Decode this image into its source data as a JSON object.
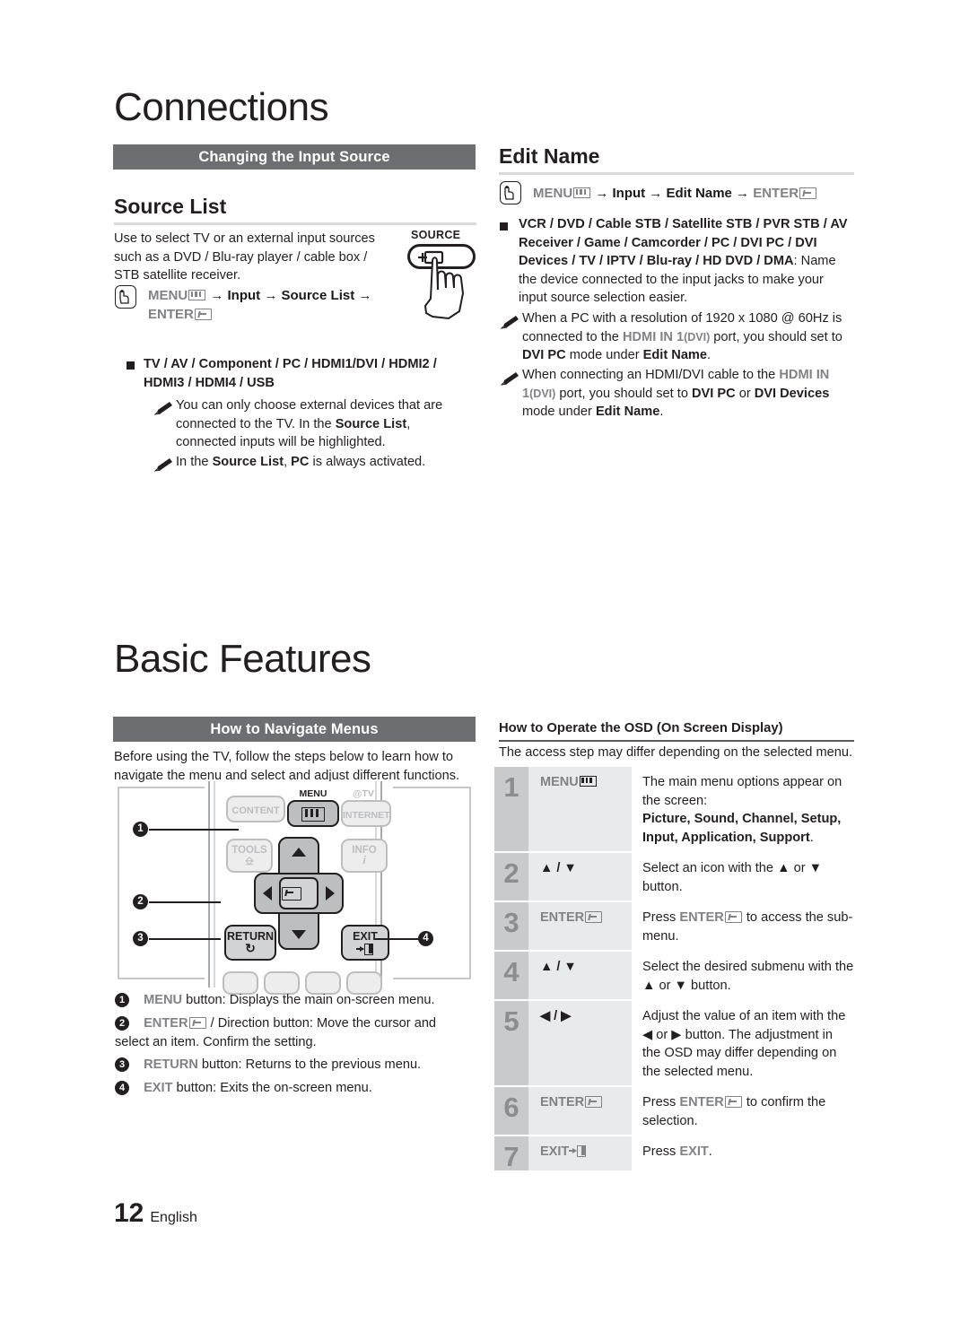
{
  "document": {
    "chapters": [
      {
        "id": "connections",
        "title": "Connections"
      },
      {
        "id": "basic",
        "title": "Basic Features"
      }
    ],
    "footer": {
      "page_number": "12",
      "language": "English"
    }
  },
  "connections": {
    "section_bar": "Changing the Input Source",
    "source_list": {
      "heading": "Source List",
      "description": "Use to select TV or an external input sources such as a DVD / Blu-ray player / cable box / STB satellite receiver.",
      "path": {
        "menu": "MENU",
        "sep1": "→",
        "item1": "Input",
        "sep2": "→",
        "item2": "Source List",
        "sep3": "→",
        "enter": "ENTER"
      },
      "bullet": "TV / AV / Component / PC / HDMI1/DVI / HDMI2 / HDMI3 / HDMI4 / USB",
      "notes": [
        {
          "p1": "You can only choose external devices that are connected to the TV. In the ",
          "b1": "Source List",
          "p2": ", connected inputs will be highlighted."
        },
        {
          "p1": "In the ",
          "b1": "Source List",
          "p2": ", ",
          "b2": "PC",
          "p3": " is always activated."
        }
      ],
      "illustration": {
        "button_label": "SOURCE"
      }
    },
    "edit_name": {
      "heading": "Edit Name",
      "path": {
        "menu": "MENU",
        "sep1": "→",
        "item1": "Input",
        "sep2": "→",
        "item2": "Edit Name",
        "sep3": "→",
        "enter": "ENTER"
      },
      "bullet_bold": "VCR / DVD / Cable STB / Satellite STB / PVR STB / AV Receiver / Game / Camcorder / PC / DVI PC / DVI Devices / TV / IPTV / Blu-ray / HD DVD / DMA",
      "bullet_rest": ": Name the device connected to the input jacks to make your input source selection easier.",
      "notes": [
        {
          "p1": "When a PC with a resolution of 1920 x 1080 @ 60Hz is connected to the ",
          "g1": "HDMI IN 1",
          "g2": "(DVI)",
          "p2": " port, you should set to ",
          "b1": "DVI PC",
          "p3": " mode under ",
          "b2": "Edit Name",
          "p4": "."
        },
        {
          "p1": "When connecting an HDMI/DVI cable to the ",
          "g1": "HDMI IN 1",
          "g2": "(DVI)",
          "p2": " port, you should set to ",
          "b1": "DVI PC",
          "p3": " or ",
          "b2": "DVI Devices",
          "p4": " mode under ",
          "b3": "Edit Name",
          "p5": "."
        }
      ]
    }
  },
  "basic_features": {
    "section_bar": "How to Navigate Menus",
    "intro": "Before using the TV, follow the steps below to learn how to navigate the menu and select and adjust different functions.",
    "remote": {
      "buttons": {
        "content": "CONTENT",
        "menu_label": "MENU",
        "attv_label": "@TV",
        "internet": "INTERNET",
        "tools": "TOOLS",
        "info": "INFO",
        "return": "RETURN",
        "exit": "EXIT"
      },
      "callouts": [
        "1",
        "2",
        "3",
        "4"
      ]
    },
    "legend": [
      {
        "num": "1",
        "key": "MENU",
        "text": " button: Displays the main on-screen menu."
      },
      {
        "num": "2",
        "key": "ENTER",
        "text": " / Direction button: Move the cursor and select an item. Confirm the setting."
      },
      {
        "num": "3",
        "key": "RETURN",
        "text": " button: Returns to the previous menu."
      },
      {
        "num": "4",
        "key": "EXIT",
        "text": " button: Exits the on-screen menu."
      }
    ],
    "osd": {
      "heading": "How to Operate the OSD (On Screen Display)",
      "intro": "The access step may differ depending on the selected menu.",
      "rows": [
        {
          "num": "1",
          "key": "MENU",
          "key_glyph": "menu",
          "desc_pre": "The main menu options appear on the screen:",
          "desc_bold": "Picture, Sound, Channel, Setup, Input, Application, Support",
          "desc_post": "."
        },
        {
          "num": "2",
          "key": "▲ / ▼",
          "key_glyph": "none",
          "desc_pre": "Select an icon with the ▲ or ▼ button.",
          "desc_bold": "",
          "desc_post": ""
        },
        {
          "num": "3",
          "key": "ENTER",
          "key_glyph": "enter",
          "desc_pre": "Press ",
          "desc_mid_key": "ENTER",
          "desc_mid_glyph": "enter",
          "desc_post": " to access the sub-menu.",
          "desc_bold": ""
        },
        {
          "num": "4",
          "key": "▲ / ▼",
          "key_glyph": "none",
          "desc_pre": "Select the desired submenu with the ▲ or ▼ button.",
          "desc_bold": "",
          "desc_post": ""
        },
        {
          "num": "5",
          "key": "◀ / ▶",
          "key_glyph": "none",
          "desc_pre": "Adjust the value of an item with the ◀ or ▶ button. The adjustment in the OSD may differ depending on the selected menu.",
          "desc_bold": "",
          "desc_post": ""
        },
        {
          "num": "6",
          "key": "ENTER",
          "key_glyph": "enter",
          "desc_pre": "Press ",
          "desc_mid_key": "ENTER",
          "desc_mid_glyph": "enter",
          "desc_post": " to confirm the selection.",
          "desc_bold": ""
        },
        {
          "num": "7",
          "key": "EXIT",
          "key_glyph": "exit",
          "desc_pre": "Press ",
          "desc_mid_key": "EXIT",
          "desc_mid_glyph": "none",
          "desc_post": ".",
          "desc_bold": ""
        }
      ]
    }
  },
  "colors": {
    "bar_gray": "#6d6e71",
    "key_gray": "#808285",
    "text_black": "#231f20",
    "table_num_bg": "#c9cacc",
    "table_key_bg": "#e9eaeb"
  }
}
